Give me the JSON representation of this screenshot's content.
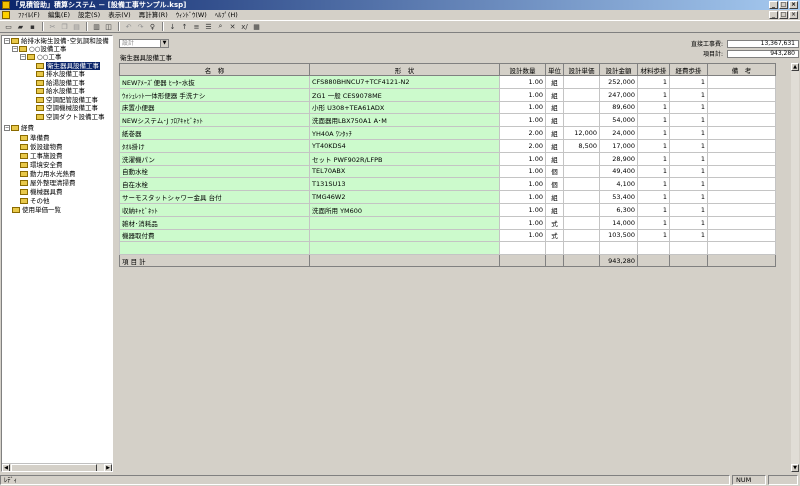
{
  "window": {
    "title": "「見積管助」積算システム － [設備工事サンプル.ksp]",
    "controls": [
      "_",
      "□",
      "×"
    ]
  },
  "menu": [
    "ﾌｧｲﾙ(F)",
    "編集(E)",
    "設定(S)",
    "表示(V)",
    "再計算(R)",
    "ｳｨﾝﾄﾞｳ(W)",
    "ﾍﾙﾌﾟ(H)"
  ],
  "tree": {
    "root": "給排水衛生設備･空気調和設備",
    "group1": "○○設備工事",
    "group2": "○○工事",
    "leaves": [
      "衛生器具設備工事",
      "排水設備工事",
      "給湯設備工事",
      "給水設備工事",
      "空調配管設備工事",
      "空調機械設備工事",
      "空調ダクト設備工事"
    ],
    "expenses": "経費",
    "expense_items": [
      "準備費",
      "仮設建物費",
      "工事施設費",
      "環境安全費",
      "動力用水光熱費",
      "屋外整理清掃費",
      "機械器具費",
      "その他"
    ],
    "unit_price_list": "使用単価一覧"
  },
  "main": {
    "combo_placeholder": "設計",
    "section_title": "衛生器具設備工事",
    "direct_cost_label": "直接工事費:",
    "direct_cost_value": "13,367,631",
    "item_total_label": "項目計:",
    "item_total_value": "943,280"
  },
  "grid": {
    "headers": [
      "名　称",
      "形　状",
      "設計数量",
      "単位",
      "設計単価",
      "設計金額",
      "材料歩掛",
      "経費歩掛",
      "備　考"
    ],
    "rows": [
      {
        "name": "NEWｱﾒｰｽﾞ便器 ﾋｰﾀｰ水抜",
        "shape": "CFS880BHNCU7+TCF4121-N2",
        "qty": "1.00",
        "unit": "組",
        "price": "",
        "amount": "252,000",
        "mat": "1",
        "exp": "1",
        "note": ""
      },
      {
        "name": "ｳｫｼｭﾚｯﾄ一体形便器 手洗ナシ",
        "shape": "ZG1 一般 CES9078ME",
        "qty": "1.00",
        "unit": "組",
        "price": "",
        "amount": "247,000",
        "mat": "1",
        "exp": "1",
        "note": ""
      },
      {
        "name": "床置小便器",
        "shape": "小形 U308+TEA61ADX",
        "qty": "1.00",
        "unit": "組",
        "price": "",
        "amount": "89,600",
        "mat": "1",
        "exp": "1",
        "note": ""
      },
      {
        "name": "NEWシステム･J ﾌﾛｱｷｬﾋﾞﾈｯﾄ",
        "shape": "洗面器用LBX750A1 A･M",
        "qty": "1.00",
        "unit": "組",
        "price": "",
        "amount": "54,000",
        "mat": "1",
        "exp": "1",
        "note": ""
      },
      {
        "name": "紙巻器",
        "shape": "YH40A ﾜﾝﾀｯﾁ",
        "qty": "2.00",
        "unit": "組",
        "price": "12,000",
        "amount": "24,000",
        "mat": "1",
        "exp": "1",
        "note": ""
      },
      {
        "name": "ﾀｵﾙ掛け",
        "shape": "YT40KDS4",
        "qty": "2.00",
        "unit": "組",
        "price": "8,500",
        "amount": "17,000",
        "mat": "1",
        "exp": "1",
        "note": ""
      },
      {
        "name": "洗濯機パン",
        "shape": "セット PWF902R/LFPB",
        "qty": "1.00",
        "unit": "組",
        "price": "",
        "amount": "28,900",
        "mat": "1",
        "exp": "1",
        "note": ""
      },
      {
        "name": "自動水栓",
        "shape": "TEL70ABX",
        "qty": "1.00",
        "unit": "個",
        "price": "",
        "amount": "49,400",
        "mat": "1",
        "exp": "1",
        "note": ""
      },
      {
        "name": "自在水栓",
        "shape": "T131SU13",
        "qty": "1.00",
        "unit": "個",
        "price": "",
        "amount": "4,100",
        "mat": "1",
        "exp": "1",
        "note": ""
      },
      {
        "name": "サーモスタットシャワー金具 台付",
        "shape": "TMG46W2",
        "qty": "1.00",
        "unit": "組",
        "price": "",
        "amount": "53,400",
        "mat": "1",
        "exp": "1",
        "note": ""
      },
      {
        "name": "収納ｷｬﾋﾞﾈｯﾄ",
        "shape": "洗面所用 YM600",
        "qty": "1.00",
        "unit": "組",
        "price": "",
        "amount": "6,300",
        "mat": "1",
        "exp": "1",
        "note": ""
      },
      {
        "name": "雑材･消耗品",
        "shape": "",
        "qty": "1.00",
        "unit": "式",
        "price": "",
        "amount": "14,000",
        "mat": "1",
        "exp": "1",
        "note": ""
      },
      {
        "name": "機器取付費",
        "shape": "",
        "qty": "1.00",
        "unit": "式",
        "price": "",
        "amount": "103,500",
        "mat": "1",
        "exp": "1",
        "note": ""
      }
    ],
    "total_label": "項 目 計",
    "total_amount": "943,280"
  },
  "status": {
    "ready": "ﾚﾃﾞｨ",
    "num": "NUM"
  }
}
